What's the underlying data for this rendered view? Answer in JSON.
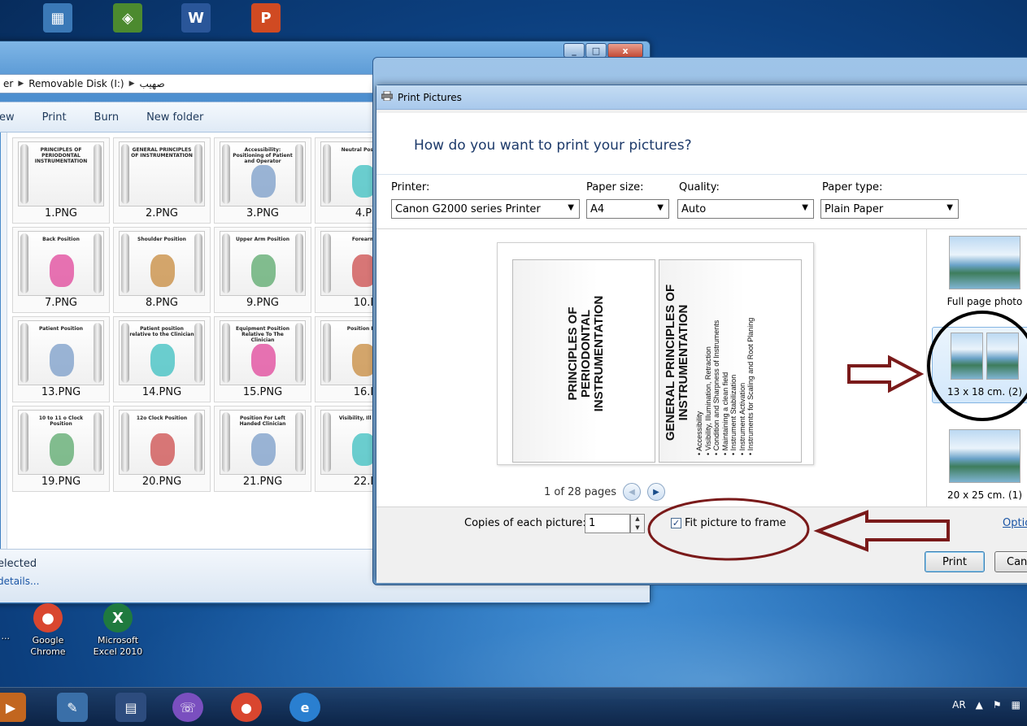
{
  "desktop": {
    "icons_top": [
      {
        "label": "",
        "glyph": "▦",
        "color": "#3b79b7",
        "icon": "document-icon"
      },
      {
        "label": "",
        "glyph": "◈",
        "color": "#4c8a2f",
        "icon": "app-shortcut-icon"
      },
      {
        "label": "",
        "glyph": "W",
        "color": "#2a5699",
        "icon": "word-icon"
      },
      {
        "label": "",
        "glyph": "P",
        "color": "#d04a22",
        "icon": "powerpoint-icon"
      }
    ],
    "icons_bottom": [
      {
        "label": "Google Chrome",
        "glyph": "●",
        "color": "#d9462f",
        "icon": "chrome-icon"
      },
      {
        "label": "Microsoft Excel 2010",
        "glyph": "X",
        "color": "#1f7a3f",
        "icon": "excel-icon"
      }
    ],
    "partial_left_label": "..."
  },
  "explorer": {
    "caption": {
      "minimize": "_",
      "maximize": "□",
      "close": "x"
    },
    "breadcrumb": [
      "er",
      "Removable Disk (I:)",
      "صهيب"
    ],
    "toolbar": [
      "ew",
      "Print",
      "Burn",
      "New folder"
    ],
    "thumbnails": [
      {
        "name": "1.PNG",
        "title": "PRINCIPLES OF PERIODONTAL INSTRUMENTATION"
      },
      {
        "name": "2.PNG",
        "title": "GENERAL PRINCIPLES OF INSTRUMENTATION"
      },
      {
        "name": "3.PNG",
        "title": "Accessibility: Positioning of Patient and Operator"
      },
      {
        "name": "4.P",
        "title": "Neutral Position"
      },
      {
        "name": "7.PNG",
        "title": "Back Position"
      },
      {
        "name": "8.PNG",
        "title": "Shoulder Position"
      },
      {
        "name": "9.PNG",
        "title": "Upper Arm Position"
      },
      {
        "name": "10.I",
        "title": "Forearm"
      },
      {
        "name": "13.PNG",
        "title": "Patient Position"
      },
      {
        "name": "14.PNG",
        "title": "Patient position relative to the Clinician"
      },
      {
        "name": "15.PNG",
        "title": "Equipment Position Relative To The Clinician"
      },
      {
        "name": "16.I",
        "title": "Position For"
      },
      {
        "name": "19.PNG",
        "title": "10 to 11 o Clock Position"
      },
      {
        "name": "20.PNG",
        "title": "12o Clock Position"
      },
      {
        "name": "21.PNG",
        "title": "Position For Left Handed Clinician"
      },
      {
        "name": "22.I",
        "title": "Visibility, Ill Retra"
      }
    ],
    "status": {
      "selected": "elected",
      "details": "details..."
    }
  },
  "dialog": {
    "title": "Print Pictures",
    "question": "How do you want to print your pictures?",
    "printer": {
      "label": "Printer:",
      "value": "Canon G2000 series Printer"
    },
    "paper_size": {
      "label": "Paper size:",
      "value": "A4"
    },
    "quality": {
      "label": "Quality:",
      "value": "Auto"
    },
    "paper_type": {
      "label": "Paper type:",
      "value": "Plain Paper"
    },
    "preview": {
      "left_title": "PRINCIPLES OF PERIODONTAL INSTRUMENTATION",
      "right_title": "GENERAL PRINCIPLES OF INSTRUMENTATION",
      "right_bullets": [
        "Accessibility",
        "Visibility, Illumination, Retraction",
        "Condition and Sharpness of Instruments",
        "Maintaining a clean field",
        "Instrument Stabilization",
        "Instrument Activation",
        "Instruments for Scaling and Root Planing"
      ]
    },
    "pager": {
      "text": "1 of 28 pages",
      "prev": "◀",
      "next": "▶"
    },
    "layouts": [
      {
        "caption": "Full page photo"
      },
      {
        "caption": "13 x 18 cm. (2)"
      },
      {
        "caption": "20 x 25 cm. (1)"
      }
    ],
    "copies": {
      "label": "Copies of each picture:",
      "value": "1"
    },
    "fit": {
      "label": "Fit picture to frame",
      "checked": true
    },
    "options_link": "Optio",
    "print_button": "Print",
    "cancel_button": "Can"
  },
  "taskbar": {
    "language": "AR",
    "tray_arrow": "▲"
  },
  "colors": {
    "annotation_red": "#7a1a1a",
    "annotation_black": "#000000",
    "link_blue": "#1a55a5"
  }
}
